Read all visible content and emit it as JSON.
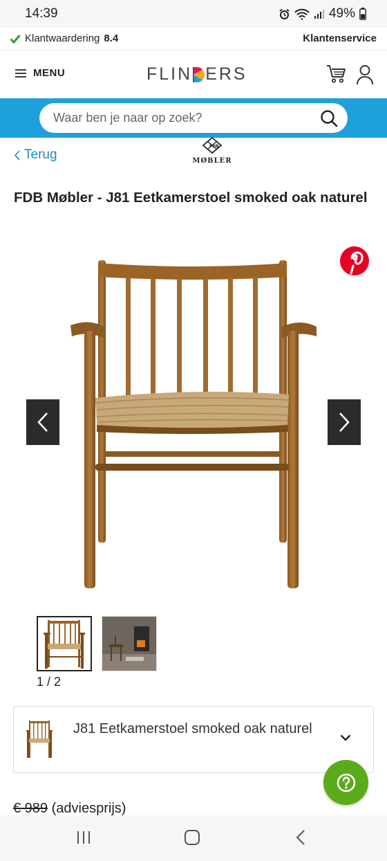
{
  "status_bar": {
    "time": "14:39",
    "battery": "49%"
  },
  "rating_bar": {
    "label": "Klantwaardering",
    "score": "8.4",
    "service_label": "Klantenservice"
  },
  "header": {
    "menu_label": "MENU",
    "logo_text_1": "FLIN",
    "logo_text_2": "ERS"
  },
  "search": {
    "placeholder": "Waar ben je naar op zoek?"
  },
  "nav": {
    "back_label": "Terug",
    "brand_name": "MØBLER",
    "brand_mark": "FDB"
  },
  "product": {
    "title": "FDB Møbler - J81 Eetkamerstoel smoked oak naturel",
    "gallery_counter": "1 / 2",
    "variant_label": "J81 Eetkamerstoel smoked oak naturel",
    "old_price": "€ 989",
    "price_note": "(adviesprijs)"
  },
  "colors": {
    "accent_blue": "#1ea0dc",
    "link_blue": "#1e8bc3",
    "help_green": "#5aab1a",
    "pinterest_red": "#e60023"
  },
  "icons": [
    "check-icon",
    "menu-icon",
    "cart-icon",
    "user-icon",
    "search-icon",
    "chevron-left-icon",
    "pinterest-icon",
    "chevron-right-icon",
    "chevron-down-icon",
    "help-icon"
  ]
}
